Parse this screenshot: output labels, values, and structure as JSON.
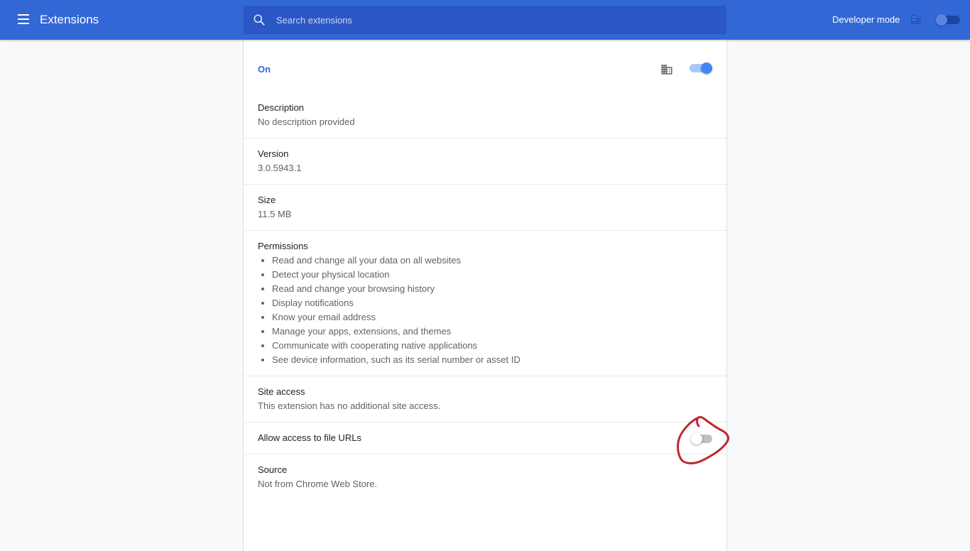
{
  "header": {
    "title": "Extensions",
    "search_placeholder": "Search extensions",
    "developer_mode_label": "Developer mode",
    "developer_mode_enabled": false
  },
  "extension": {
    "status_label": "On",
    "enabled": true,
    "description": {
      "label": "Description",
      "value": "No description provided"
    },
    "version": {
      "label": "Version",
      "value": "3.0.5943.1"
    },
    "size": {
      "label": "Size",
      "value": "11.5 MB"
    },
    "permissions": {
      "label": "Permissions",
      "items": [
        "Read and change all your data on all websites",
        "Detect your physical location",
        "Read and change your browsing history",
        "Display notifications",
        "Know your email address",
        "Manage your apps, extensions, and themes",
        "Communicate with cooperating native applications",
        "See device information, such as its serial number or asset ID"
      ]
    },
    "site_access": {
      "label": "Site access",
      "value": "This extension has no additional site access."
    },
    "file_urls": {
      "label": "Allow access to file URLs",
      "enabled": false
    },
    "source": {
      "label": "Source",
      "value": "Not from Chrome Web Store."
    }
  },
  "icons": {
    "menu": "menu-icon",
    "search": "search-icon",
    "policy": "building-icon",
    "annotation": "red-circle-annotation"
  },
  "colors": {
    "toolbar": "#3367d6",
    "search_bg": "#2a56c6",
    "accent": "#4285f4",
    "annotation": "#c0272d"
  }
}
